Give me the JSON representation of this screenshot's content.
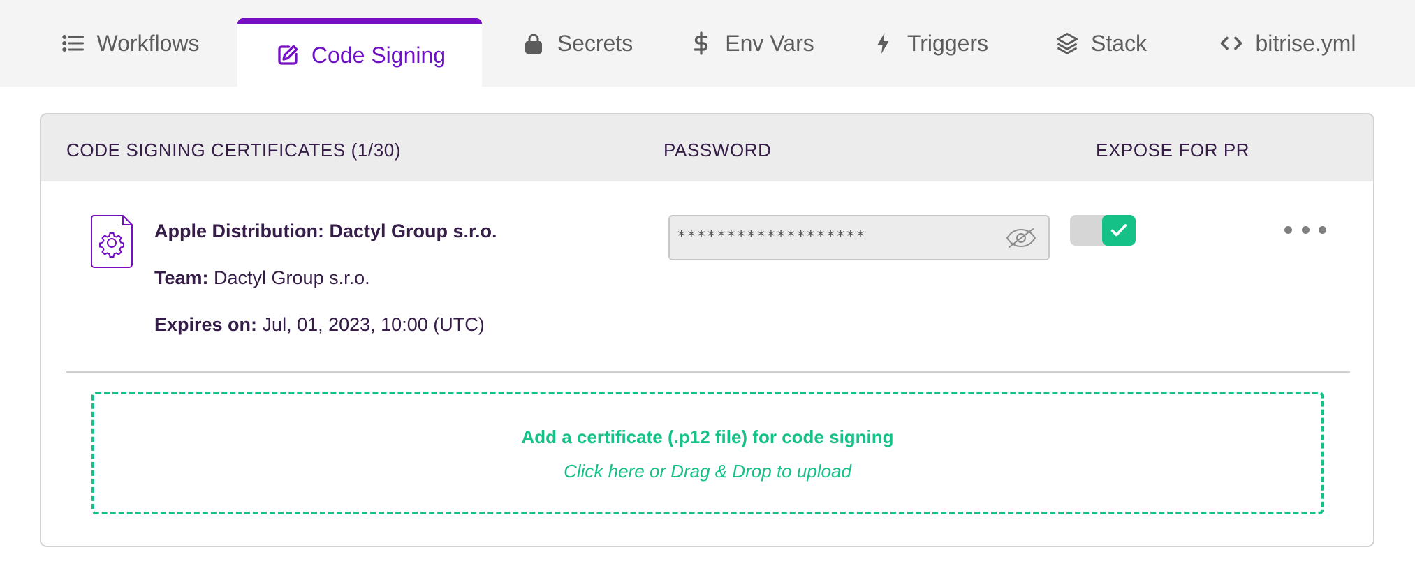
{
  "tabs": [
    {
      "label": "Workflows",
      "icon": "list-icon",
      "active": false
    },
    {
      "label": "Code Signing",
      "icon": "edit-square-icon",
      "active": true
    },
    {
      "label": "Secrets",
      "icon": "lock-icon",
      "active": false
    },
    {
      "label": "Env Vars",
      "icon": "dollar-icon",
      "active": false
    },
    {
      "label": "Triggers",
      "icon": "lightning-icon",
      "active": false
    },
    {
      "label": "Stack",
      "icon": "layers-icon",
      "active": false
    },
    {
      "label": "bitrise.yml",
      "icon": "code-icon",
      "active": false
    }
  ],
  "table": {
    "col_certificates": "CODE SIGNING CERTIFICATES (1/30)",
    "col_password": "PASSWORD",
    "col_expose": "EXPOSE FOR PR"
  },
  "certificate": {
    "name": "Apple Distribution: Dactyl Group s.r.o.",
    "team_label": "Team:",
    "team_value": " Dactyl Group s.r.o.",
    "expires_label": "Expires on:",
    "expires_value": " Jul, 01, 2023, 10:00 (UTC)",
    "password_mask": "*******************",
    "expose_for_pr": true
  },
  "dropzone": {
    "title": "Add a certificate (.p12 file) for code signing",
    "subtitle": "Click here or Drag & Drop to upload"
  },
  "colors": {
    "accent_purple": "#760fc3",
    "success_green": "#15c187",
    "text_dark": "#351d48"
  }
}
